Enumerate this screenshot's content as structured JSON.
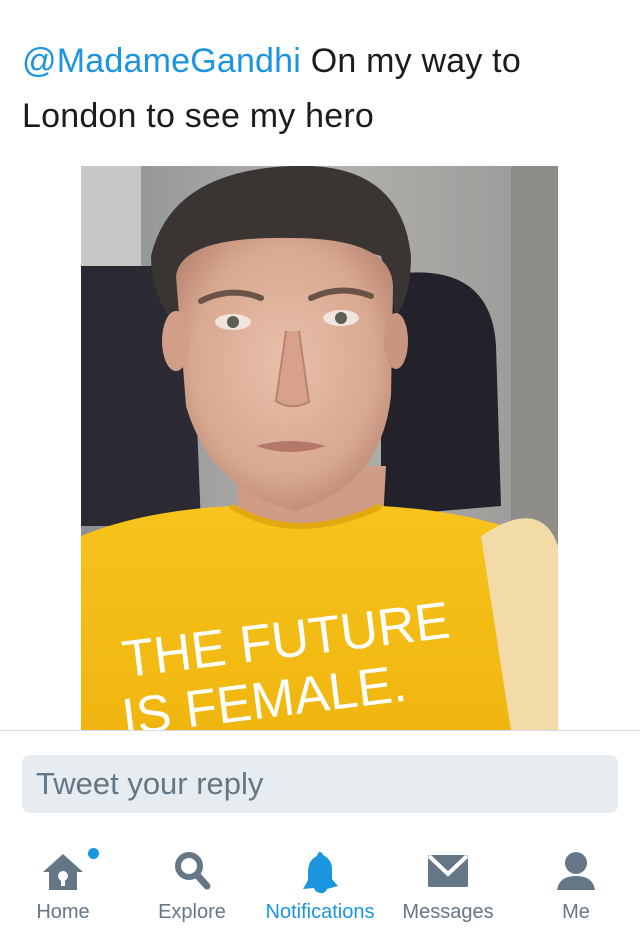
{
  "tweet": {
    "mention": "@MadameGandhi",
    "text": " On my way to London to see my hero",
    "photo_shirt_text": [
      "THE FUTURE",
      "IS FEMALE."
    ]
  },
  "reply": {
    "placeholder": "Tweet your reply"
  },
  "tabbar": {
    "items": [
      {
        "label": "Home",
        "icon": "home-icon",
        "has_badge": true
      },
      {
        "label": "Explore",
        "icon": "search-icon"
      },
      {
        "label": "Notifications",
        "icon": "bell-icon",
        "active": true
      },
      {
        "label": "Messages",
        "icon": "envelope-icon"
      },
      {
        "label": "Me",
        "icon": "person-icon"
      }
    ]
  },
  "colors": {
    "accent": "#1b95e0",
    "inactive": "#657786",
    "reply_bg": "#e6ecf0",
    "shirt": "#f7c31c"
  }
}
